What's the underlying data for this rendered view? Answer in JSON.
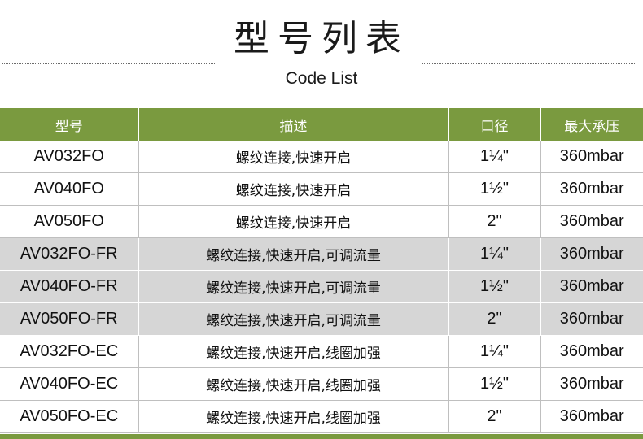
{
  "header": {
    "title": "型号列表",
    "subtitle": "Code List"
  },
  "table": {
    "columns": [
      "型号",
      "描述",
      "口径",
      "最大承压"
    ],
    "rows": [
      {
        "model": "AV032FO",
        "desc": "螺纹连接,快速开启",
        "port": "1¼\"",
        "pressure": "360mbar",
        "shaded": false
      },
      {
        "model": "AV040FO",
        "desc": "螺纹连接,快速开启",
        "port": "1½\"",
        "pressure": "360mbar",
        "shaded": false
      },
      {
        "model": "AV050FO",
        "desc": "螺纹连接,快速开启",
        "port": "2\"",
        "pressure": "360mbar",
        "shaded": false
      },
      {
        "model": "AV032FO-FR",
        "desc": "螺纹连接,快速开启,可调流量",
        "port": "1¼\"",
        "pressure": "360mbar",
        "shaded": true
      },
      {
        "model": "AV040FO-FR",
        "desc": "螺纹连接,快速开启,可调流量",
        "port": "1½\"",
        "pressure": "360mbar",
        "shaded": true
      },
      {
        "model": "AV050FO-FR",
        "desc": "螺纹连接,快速开启,可调流量",
        "port": "2\"",
        "pressure": "360mbar",
        "shaded": true
      },
      {
        "model": "AV032FO-EC",
        "desc": "螺纹连接,快速开启,线圈加强",
        "port": "1¼\"",
        "pressure": "360mbar",
        "shaded": false
      },
      {
        "model": "AV040FO-EC",
        "desc": "螺纹连接,快速开启,线圈加强",
        "port": "1½\"",
        "pressure": "360mbar",
        "shaded": false
      },
      {
        "model": "AV050FO-EC",
        "desc": "螺纹连接,快速开启,线圈加强",
        "port": "2\"",
        "pressure": "360mbar",
        "shaded": false
      }
    ]
  },
  "colors": {
    "header_bg": "#7a9a3f",
    "shaded_row_bg": "#d6d6d6"
  }
}
